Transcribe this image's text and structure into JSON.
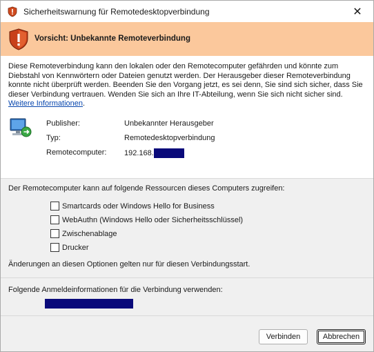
{
  "window": {
    "title": "Sicherheitswarnung für Remotedesktopverbindung",
    "close_glyph": "✕"
  },
  "banner": {
    "text": "Vorsicht: Unbekannte Remoteverbindung",
    "color": "#fbc89c"
  },
  "description": {
    "text": "Diese Remoteverbindung kann den lokalen oder den Remotecomputer gefährden und könnte zum Diebstahl von Kennwörtern oder Dateien genutzt werden. Der Herausgeber dieser Remoteverbindung konnte nicht überprüft werden. Beenden Sie den Vorgang jetzt, es sei denn, Sie sind sich sicher, dass Sie dieser Verbindung vertrauen. Wenden Sie sich an Ihre IT-Abteilung, wenn Sie sich nicht sicher sind.",
    "link": "Weitere Informationen",
    "link_suffix": "."
  },
  "info": {
    "publisher_label": "Publisher:",
    "publisher_value": "Unbekannter Herausgeber",
    "type_label": "Typ:",
    "type_value": "Remotedesktopverbindung",
    "remote_label": "Remotecomputer:",
    "remote_value": "192.168."
  },
  "resources": {
    "title": "Der Remotecomputer kann auf folgende Ressourcen dieses Computers zugreifen:",
    "items": [
      {
        "label": "Smartcards oder Windows Hello for Business",
        "checked": false
      },
      {
        "label": "WebAuthn (Windows Hello oder Sicherheitsschlüssel)",
        "checked": false
      },
      {
        "label": "Zwischenablage",
        "checked": false
      },
      {
        "label": "Drucker",
        "checked": false
      }
    ],
    "note": "Änderungen an diesen Optionen gelten nur für diesen Verbindungsstart."
  },
  "credentials": {
    "title": "Folgende Anmeldeinformationen für die Verbindung verwenden:"
  },
  "buttons": {
    "connect": "Verbinden",
    "cancel": "Abbrechen"
  },
  "colors": {
    "redaction": "#0a0a7a",
    "link": "#0645ad"
  }
}
